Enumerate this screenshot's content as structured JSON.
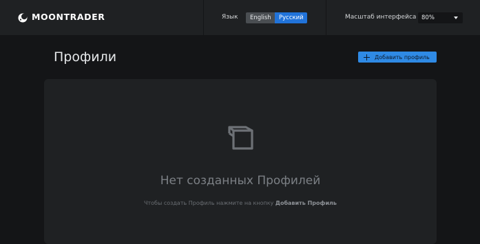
{
  "app": {
    "logo_text": "MOONTRADER",
    "logo_icon": "moontrader-logo-icon"
  },
  "header": {
    "language_label": "Язык",
    "languages": [
      "English",
      "Русский"
    ],
    "selected_language": "Русский",
    "scale_label": "Масштаб интерфейса",
    "scale_value": "80%"
  },
  "page": {
    "title": "Профили",
    "add_button_label": "Добавить профиль",
    "add_button_icon": "plus-icon"
  },
  "empty_state": {
    "icon": "cube-icon",
    "title": "Нет созданных Профилей",
    "hint_prefix": "Чтобы создать Профиль нажмите на кнопку ",
    "hint_action": "Добавить Профиль"
  },
  "colors": {
    "background": "#141517",
    "surface": "#1f2123",
    "accent": "#2f8ae5",
    "selected_language": "#2173d9"
  }
}
